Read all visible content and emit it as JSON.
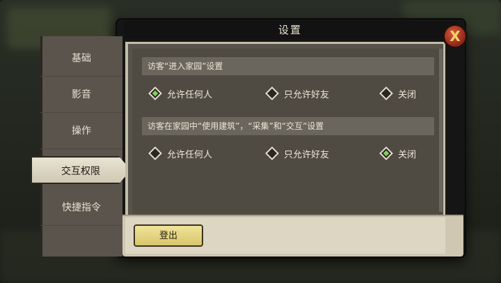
{
  "dialog": {
    "title": "设置"
  },
  "sidebar": {
    "tabs": [
      {
        "label": "基础"
      },
      {
        "label": "影音"
      },
      {
        "label": "操作"
      },
      {
        "label": "交互权限",
        "active": true
      },
      {
        "label": "快捷指令"
      }
    ]
  },
  "sections": [
    {
      "header": "访客“进入家园”设置",
      "options": [
        {
          "label": "允许任何人",
          "selected": true
        },
        {
          "label": "只允许好友",
          "selected": false
        },
        {
          "label": "关闭",
          "selected": false
        }
      ]
    },
    {
      "header": "访客在家园中“使用建筑”，“采集”和“交互”设置",
      "options": [
        {
          "label": "允许任何人",
          "selected": false
        },
        {
          "label": "只允许好友",
          "selected": false
        },
        {
          "label": "关闭",
          "selected": true
        }
      ]
    }
  ],
  "footer": {
    "logout_label": "登出"
  },
  "close_icon_glyph": "X",
  "colors": {
    "accent_selected": "#7fd05c",
    "button_yellow": "#e8da86",
    "close_red": "#b83a24"
  }
}
